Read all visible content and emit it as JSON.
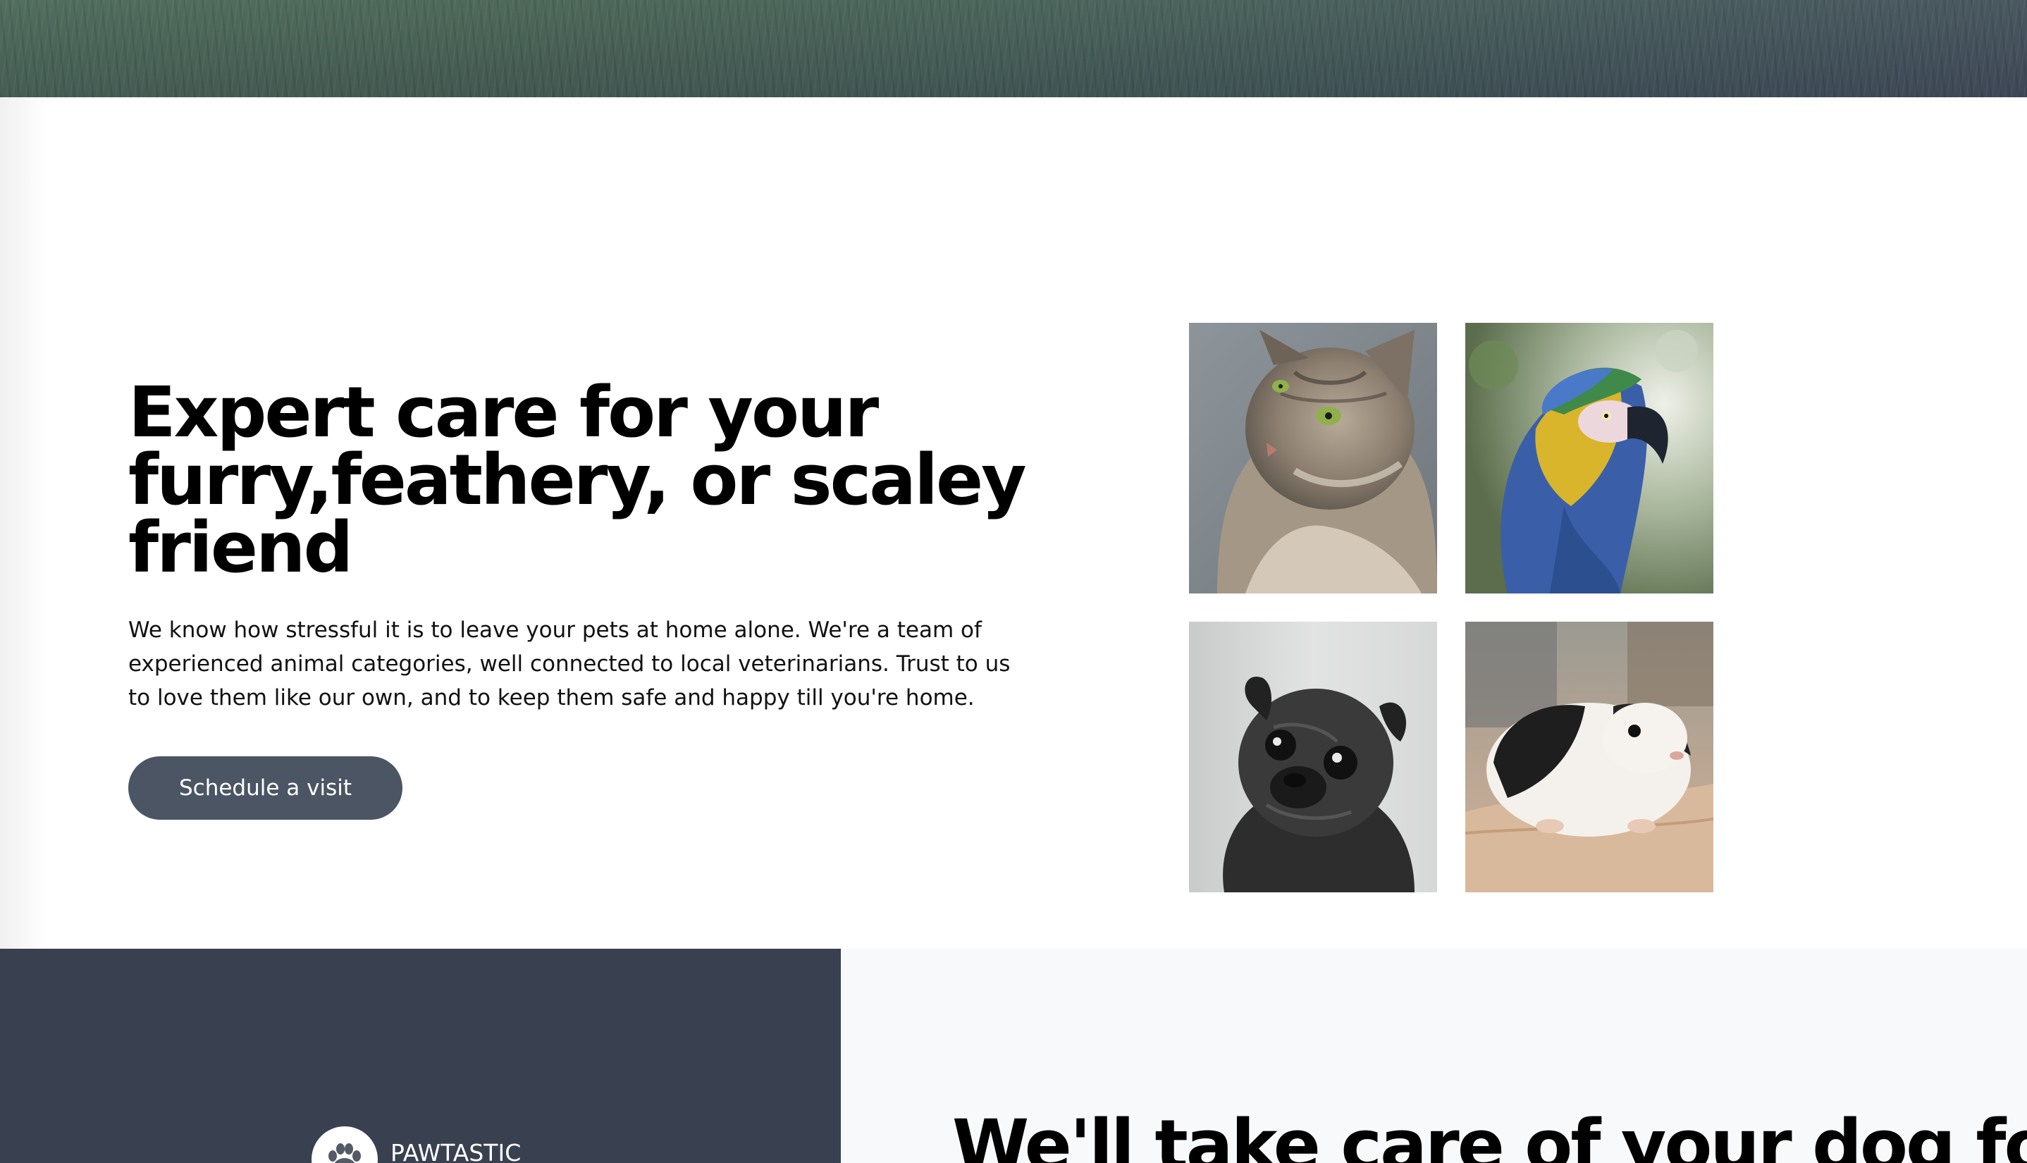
{
  "intro": {
    "title": "Expert care for your furry,feathery, or scaley friend",
    "text": "We know how stressful it is to leave your pets at home alone. We're a team of experienced animal categories, well connected to local veterinarians. Trust to us to love them like our own, and to keep them safe and happy till you're home.",
    "button_label": "Schedule a visit"
  },
  "gallery": {
    "images": [
      "cat",
      "parrot",
      "pug",
      "guinea-pig"
    ]
  },
  "brand": {
    "name": "PAWTASTIC",
    "logo_icon": "paw-icon"
  },
  "dog_care": {
    "title": "We'll take care of your dog for"
  },
  "colors": {
    "button": "#4b5563",
    "footer_dark": "#394050",
    "section_light": "#f8f9fb"
  }
}
